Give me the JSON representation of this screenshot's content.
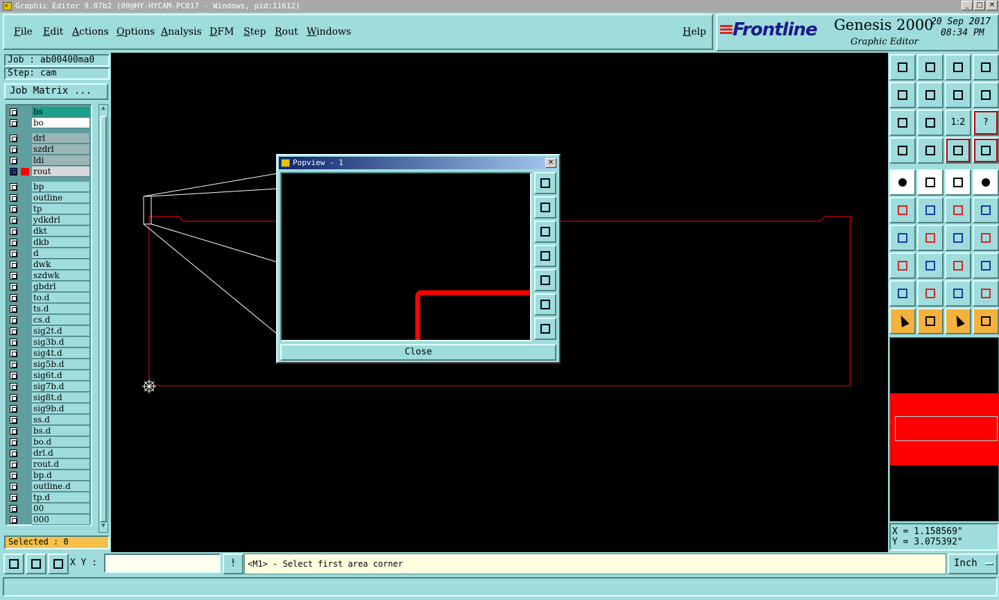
{
  "window": {
    "title": "Graphic Editor 9.07b2 (00@HY-HYCAM-PC017 - Windows, pid:11612)",
    "controls": [
      "_",
      "□",
      "✕"
    ]
  },
  "menu": [
    "File",
    "Edit",
    "Actions",
    "Options",
    "Analysis",
    "DFM",
    "Step",
    "Rout",
    "Windows"
  ],
  "help_label": "Help",
  "logo": {
    "brand": "Frontline",
    "product": "Genesis 2000",
    "subtitle": "Graphic Editor",
    "date": "20 Sep 2017",
    "time": "08:34 PM"
  },
  "job": {
    "job_label": "Job : ab00400ma0",
    "step_label": "Step: cam",
    "matrix_button": "Job Matrix ..."
  },
  "layers": [
    {
      "name": "bs",
      "color": "#1aa08a",
      "state": "work"
    },
    {
      "name": "bo",
      "color": "#ffffff",
      "state": "affected"
    },
    {
      "name": "drl",
      "color": "#9ab6b6",
      "state": "group"
    },
    {
      "name": "szdrl",
      "color": "#9ab6b6",
      "state": "group"
    },
    {
      "name": "ldi",
      "color": "#9ab6b6",
      "state": "group"
    },
    {
      "name": "rout",
      "color": "#d8d8d8",
      "state": "display-red"
    },
    {
      "name": "bp",
      "color": "#9fdcdc",
      "state": ""
    },
    {
      "name": "outline",
      "color": "#9fdcdc",
      "state": ""
    },
    {
      "name": "tp",
      "color": "#9fdcdc",
      "state": ""
    },
    {
      "name": "ydkdrl",
      "color": "#9fdcdc",
      "state": ""
    },
    {
      "name": "dkt",
      "color": "#9fdcdc",
      "state": ""
    },
    {
      "name": "dkb",
      "color": "#9fdcdc",
      "state": ""
    },
    {
      "name": "d",
      "color": "#9fdcdc",
      "state": ""
    },
    {
      "name": "dwk",
      "color": "#9fdcdc",
      "state": ""
    },
    {
      "name": "szdwk",
      "color": "#9fdcdc",
      "state": ""
    },
    {
      "name": "gbdrl",
      "color": "#9fdcdc",
      "state": ""
    },
    {
      "name": "to.d",
      "color": "#9fdcdc",
      "state": ""
    },
    {
      "name": "ts.d",
      "color": "#9fdcdc",
      "state": ""
    },
    {
      "name": "cs.d",
      "color": "#9fdcdc",
      "state": ""
    },
    {
      "name": "sig2t.d",
      "color": "#9fdcdc",
      "state": ""
    },
    {
      "name": "sig3b.d",
      "color": "#9fdcdc",
      "state": ""
    },
    {
      "name": "sig4t.d",
      "color": "#9fdcdc",
      "state": ""
    },
    {
      "name": "sig5b.d",
      "color": "#9fdcdc",
      "state": ""
    },
    {
      "name": "sig6t.d",
      "color": "#9fdcdc",
      "state": ""
    },
    {
      "name": "sig7b.d",
      "color": "#9fdcdc",
      "state": ""
    },
    {
      "name": "sig8t.d",
      "color": "#9fdcdc",
      "state": ""
    },
    {
      "name": "sig9b.d",
      "color": "#9fdcdc",
      "state": ""
    },
    {
      "name": "ss.d",
      "color": "#9fdcdc",
      "state": ""
    },
    {
      "name": "bs.d",
      "color": "#9fdcdc",
      "state": ""
    },
    {
      "name": "bo.d",
      "color": "#9fdcdc",
      "state": ""
    },
    {
      "name": "drl.d",
      "color": "#9fdcdc",
      "state": ""
    },
    {
      "name": "rout.d",
      "color": "#9fdcdc",
      "state": ""
    },
    {
      "name": "bp.d",
      "color": "#9fdcdc",
      "state": ""
    },
    {
      "name": "outline.d",
      "color": "#9fdcdc",
      "state": ""
    },
    {
      "name": "tp.d",
      "color": "#9fdcdc",
      "state": ""
    },
    {
      "name": "00",
      "color": "#9fdcdc",
      "state": ""
    },
    {
      "name": "000",
      "color": "#9fdcdc",
      "state": ""
    }
  ],
  "selected_label": "Selected : 0",
  "popview": {
    "title": "Popview - 1",
    "close_label": "Close",
    "close_x": "✕"
  },
  "right_tools": {
    "ratio_label": "1:2",
    "help_label": "?"
  },
  "coords": {
    "x_label": "X = 1.158569\"",
    "y_label": "Y = 3.075392\""
  },
  "bottom": {
    "xy_label": "X Y :",
    "xy_value": "",
    "exclaim": "!",
    "prompt": "<M1> - Select first area corner",
    "units": "Inch"
  },
  "status_text": "",
  "colors": {
    "panel": "#9fdcdc",
    "canvas": "#000000",
    "rout_line": "#ff0000",
    "selected_bg": "#f6c14a",
    "prompt_bg": "#ffffe0"
  }
}
